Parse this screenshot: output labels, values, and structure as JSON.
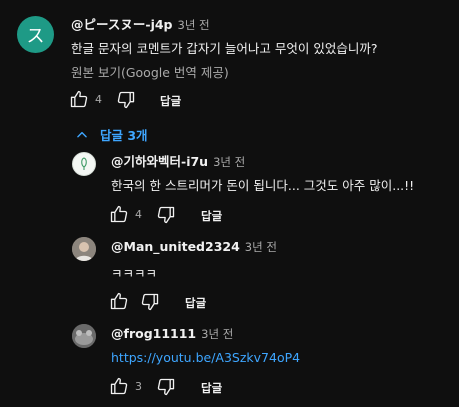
{
  "comment": {
    "avatar_letter": "ス",
    "avatar_color": "#1e9a86",
    "author": "@ピースヌー-j4p",
    "time": "3년 전",
    "text": "한글 문자의 코멘트가 갑자기 늘어나고 무엇이 있었습니까?",
    "translate": "원본 보기(Google 번역 제공)",
    "likes": "4",
    "reply_label": "답글"
  },
  "replies_toggle": {
    "label": "답글 3개"
  },
  "replies": [
    {
      "author": "@기하와벡터-i7u",
      "time": "3년 전",
      "text": "한국의 한 스트리머가 돈이 됩니다... 그것도 아주 많이...!!",
      "likes": "4",
      "reply_label": "답글"
    },
    {
      "author": "@Man_united2324",
      "time": "3년 전",
      "text": "ㅋㅋㅋㅋ",
      "likes": "",
      "reply_label": "답글"
    },
    {
      "author": "@frog11111",
      "time": "3년 전",
      "link": "https://youtu.be/A3Szkv74oP4",
      "likes": "3",
      "reply_label": "답글"
    }
  ],
  "colors": {
    "background": "#0f0f0f",
    "link": "#3ea6ff",
    "muted": "#aaaaaa"
  }
}
